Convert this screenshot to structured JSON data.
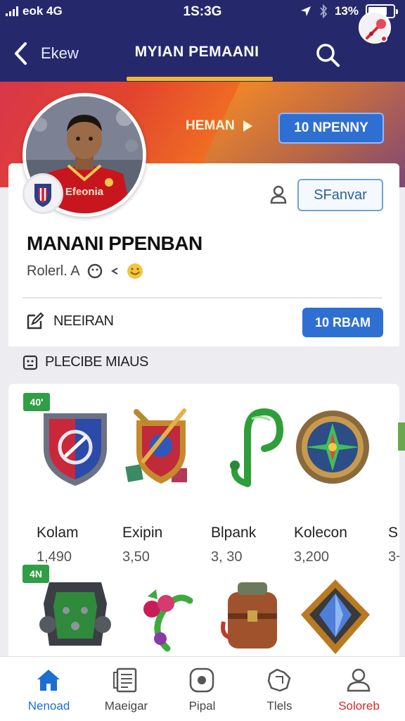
{
  "status_bar": {
    "carrier": "eok 4G",
    "time": "1S:3G",
    "battery": "13%"
  },
  "nav": {
    "back_label": "Ekew",
    "title": "MYIAN PEMAANI"
  },
  "banner": {
    "link_label": "HEMAN",
    "button_label": "10 NPENNY"
  },
  "profile": {
    "follow_label": "SFanvar",
    "name": "MANANI PPENBAN",
    "meta": "Rolerl. A",
    "edit_label": "NEEIRAN",
    "action_label": "10 RBAM",
    "jersey_text": "Efeonia"
  },
  "section": {
    "title": "PLECIBE MIAUS"
  },
  "items": {
    "row1_badge": "40'",
    "row2_badge": "4N",
    "row1": [
      {
        "name": "Kolam",
        "value": "1,490"
      },
      {
        "name": "Exipin",
        "value": "3,50"
      },
      {
        "name": "Blpank",
        "value": "3, 30"
      },
      {
        "name": "Kolecon",
        "value": "3,200"
      },
      {
        "name": "S",
        "value": "3+"
      }
    ]
  },
  "bottom_nav": [
    {
      "label": "Nenoad"
    },
    {
      "label": "Maeigar"
    },
    {
      "label": "Pipal"
    },
    {
      "label": "Tlels"
    },
    {
      "label": "Soloreb"
    }
  ],
  "colors": {
    "nav_bg": "#25296c",
    "accent": "#2f6fd2",
    "highlight": "#f4b72e",
    "badge": "#2f9e46"
  }
}
